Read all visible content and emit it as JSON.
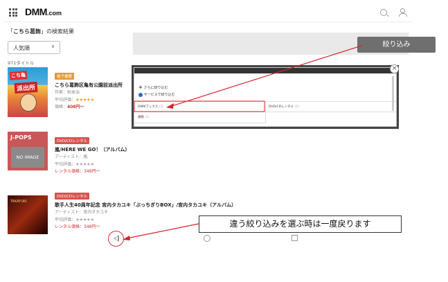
{
  "header": {
    "logo": "DMM",
    "logo_suffix": ".com"
  },
  "search": {
    "query": "こちら葛飾",
    "suffix": "」の検索結果",
    "prefix": "「"
  },
  "sort": {
    "selected": "人気順"
  },
  "count": "971タイトル",
  "filter_button": "絞り込み",
  "items": [
    {
      "badge": "電子書籍",
      "title": "こちら葛飾区亀有公園前派出所",
      "author": "作家：秋本治",
      "rating_label": "平均評価：",
      "stars": "★★★★★",
      "price_label": "価格：",
      "price": "408円〜",
      "cover_text_1": "こち亀",
      "cover_text_2": "派出所"
    },
    {
      "badge": "DVD/CDレンタル",
      "title": "嵐/HERE WE GO！（アルバム）",
      "artist": "アーティスト：嵐",
      "rating_label": "平均評価：",
      "stars": "★★★★★",
      "price": "レンタル価格：348円〜",
      "cover_genre": "J-POPS",
      "cover_noimage": "NO IMAGE"
    },
    {
      "badge": "DVD/CDレンタル",
      "title": "歌手人生40周年記念 宮内タカユキ「ぶっちぎりBOX」/宮内タカユキ（アルバム）",
      "artist": "アーティスト：宮内タカユキ",
      "rating_label": "平均評価：",
      "stars": "★★★★★",
      "price": "レンタル価格：348円〜",
      "cover_text": "TAKAYUKI"
    }
  ],
  "modal": {
    "close": "×",
    "more_filters": "さらに絞り込む",
    "service_filter": "サービスで絞り込む",
    "options": [
      {
        "label": "DMMブックス",
        "count": "(3)"
      },
      {
        "label": "DVD/CDレンタル",
        "count": "(2)"
      },
      {
        "label": "通販",
        "count": "(1)"
      }
    ]
  },
  "callout": "違う絞り込みを選ぶ時は一度戻ります",
  "colors": {
    "accent_red": "#d9232d",
    "filter_gray": "#6f6f6f"
  }
}
